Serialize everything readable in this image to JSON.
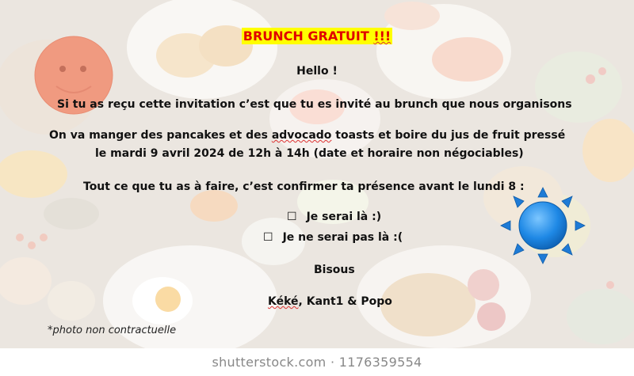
{
  "invitation": {
    "title_text": "BRUNCH GRATUIT",
    "title_marks": "!!!",
    "greeting": "Hello !",
    "line1": "Si tu as reçu cette invitation c’est que tu es invité au brunch que nous organisons",
    "line2_before": "On va manger des pancakes et des ",
    "line2_word": "advocado",
    "line2_after": " toasts et boire du jus de fruit pressé",
    "line3": "le mardi 9 avril 2024 de 12h à 14h (date et horaire non négociables)",
    "line4": "Tout ce que tu as à faire, c’est confirmer ta présence avant le lundi 8 :",
    "options": [
      {
        "box": "☐",
        "label": "Je serai là :)"
      },
      {
        "box": "☐",
        "label": "Je ne serai pas là :("
      }
    ],
    "closing": "Bisous",
    "signature_name1": "Kéké",
    "signature_rest": ", Kant1 & Popo",
    "note": "*photo non contractuelle"
  },
  "watermark": "shutterstock.com · 1176359554",
  "colors": {
    "title_text": "#e00000",
    "title_highlight": "#ffff00",
    "smiley": "#f09a80",
    "sun": "#1e88e5"
  },
  "icons": [
    "smiley-face-icon",
    "sun-icon"
  ]
}
